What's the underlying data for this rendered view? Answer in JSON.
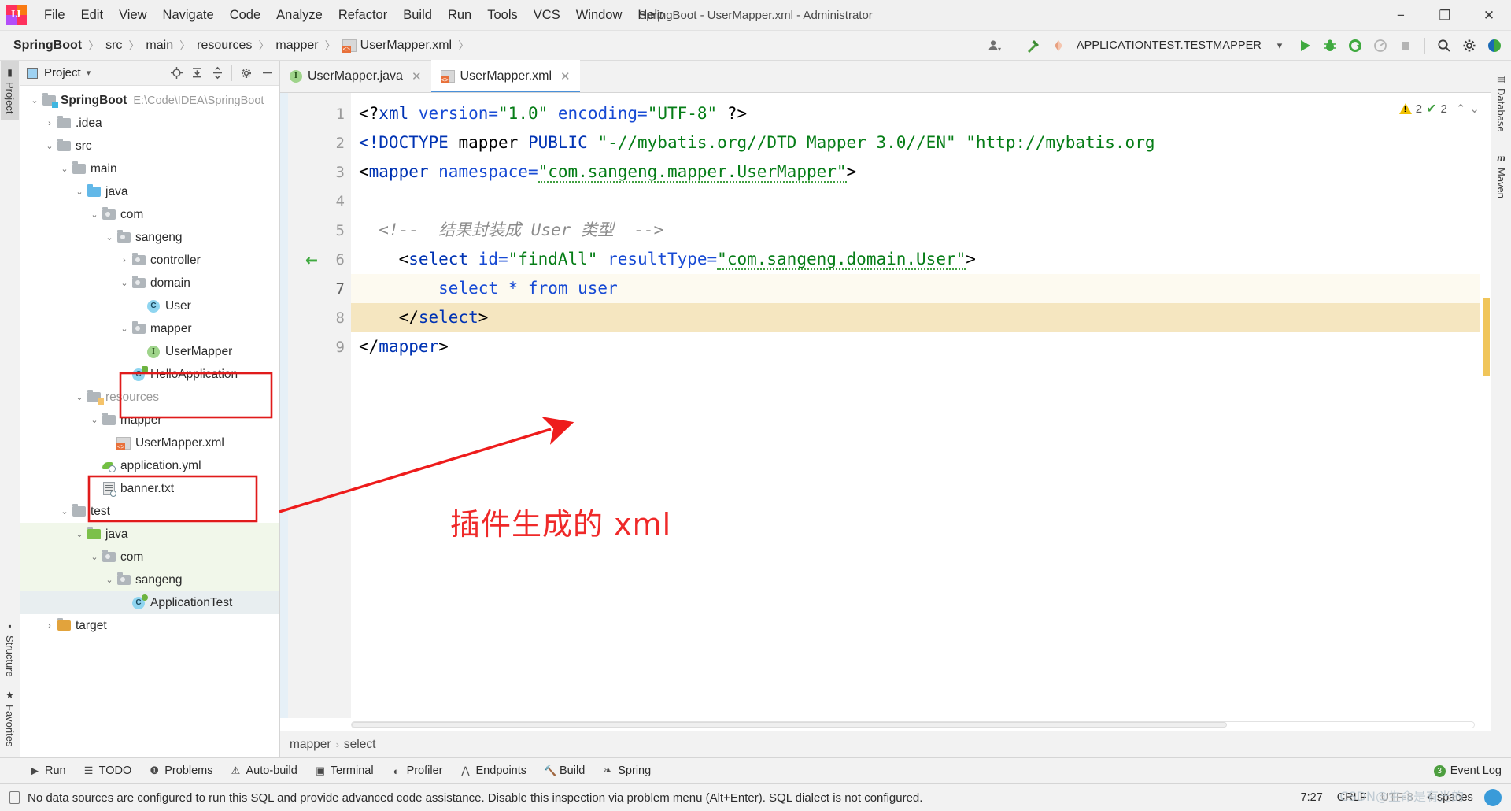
{
  "window": {
    "title": "SpringBoot - UserMapper.xml - Administrator",
    "logo_letters": "IJ",
    "minimize": "−",
    "maximize": "❐",
    "close": "✕"
  },
  "menubar": {
    "items": [
      {
        "label": "File",
        "mnemonic": "F"
      },
      {
        "label": "Edit",
        "mnemonic": "E"
      },
      {
        "label": "View",
        "mnemonic": "V"
      },
      {
        "label": "Navigate",
        "mnemonic": "N"
      },
      {
        "label": "Code",
        "mnemonic": "C"
      },
      {
        "label": "Analyze",
        "mnemonic": "z"
      },
      {
        "label": "Refactor",
        "mnemonic": "R"
      },
      {
        "label": "Build",
        "mnemonic": "B"
      },
      {
        "label": "Run",
        "mnemonic": "u"
      },
      {
        "label": "Tools",
        "mnemonic": "T"
      },
      {
        "label": "VCS",
        "mnemonic": "S"
      },
      {
        "label": "Window",
        "mnemonic": "W"
      },
      {
        "label": "Help",
        "mnemonic": "H"
      }
    ]
  },
  "breadcrumb_nav": {
    "items": [
      "SpringBoot",
      "src",
      "main",
      "resources",
      "mapper",
      "UserMapper.xml"
    ],
    "separator": "〉"
  },
  "nav_right": {
    "run_config": "APPLICATIONTEST.TESTMAPPER",
    "dropdown_caret": "▾",
    "icons": {
      "user": "user-icon",
      "build_hammer": "build-hammer-icon",
      "run": "▶",
      "debug": "debug-icon",
      "run_coverage": "run-coverage-icon",
      "profile": "profiler-icon",
      "stop": "■",
      "search": "⌕",
      "settings": "⚙",
      "ide_help": "ide-ball-icon"
    }
  },
  "left_strip": {
    "tabs": [
      {
        "label": "Project",
        "active": true
      },
      {
        "label": "Structure",
        "active": false
      },
      {
        "label": "Favorites",
        "active": false
      }
    ]
  },
  "right_strip": {
    "tabs": [
      {
        "label": "Database",
        "icon": "database-icon"
      },
      {
        "label": "Maven",
        "icon": "maven-icon"
      }
    ]
  },
  "project_panel": {
    "title": "Project",
    "caret": "▾",
    "actions": [
      "locate-icon",
      "expand-all-icon",
      "collapse-all-icon",
      "gear-icon",
      "hide-icon"
    ],
    "tree": [
      {
        "depth": 0,
        "arrow": "⌄",
        "icon": "project-folder",
        "label": "SpringBoot",
        "bold": true,
        "path": "E:\\Code\\IDEA\\SpringBoot"
      },
      {
        "depth": 1,
        "arrow": "›",
        "icon": "folder",
        "label": ".idea"
      },
      {
        "depth": 1,
        "arrow": "⌄",
        "icon": "folder",
        "label": "src"
      },
      {
        "depth": 2,
        "arrow": "⌄",
        "icon": "folder",
        "label": "main"
      },
      {
        "depth": 3,
        "arrow": "⌄",
        "icon": "folder-blue",
        "label": "java"
      },
      {
        "depth": 4,
        "arrow": "⌄",
        "icon": "package",
        "label": "com"
      },
      {
        "depth": 5,
        "arrow": "⌄",
        "icon": "package",
        "label": "sangeng"
      },
      {
        "depth": 6,
        "arrow": "›",
        "icon": "package",
        "label": "controller"
      },
      {
        "depth": 6,
        "arrow": "⌄",
        "icon": "package",
        "label": "domain"
      },
      {
        "depth": 7,
        "arrow": "",
        "icon": "class",
        "label": "User"
      },
      {
        "depth": 6,
        "arrow": "⌄",
        "icon": "package",
        "label": "mapper",
        "highlighted": true
      },
      {
        "depth": 7,
        "arrow": "",
        "icon": "interface",
        "label": "UserMapper",
        "highlighted": true
      },
      {
        "depth": 6,
        "arrow": "",
        "icon": "spring-class",
        "label": "HelloApplication"
      },
      {
        "depth": 3,
        "arrow": "⌄",
        "icon": "resources-folder",
        "label": "resources",
        "dim": true
      },
      {
        "depth": 4,
        "arrow": "⌄",
        "icon": "folder",
        "label": "mapper",
        "highlighted": true
      },
      {
        "depth": 5,
        "arrow": "",
        "icon": "xml",
        "label": "UserMapper.xml",
        "highlighted": true
      },
      {
        "depth": 4,
        "arrow": "",
        "icon": "yml",
        "label": "application.yml"
      },
      {
        "depth": 4,
        "arrow": "",
        "icon": "txt",
        "label": "banner.txt"
      },
      {
        "depth": 2,
        "arrow": "⌄",
        "icon": "folder",
        "label": "test"
      },
      {
        "depth": 3,
        "arrow": "⌄",
        "icon": "folder-green",
        "label": "java",
        "testroot": true
      },
      {
        "depth": 4,
        "arrow": "⌄",
        "icon": "package",
        "label": "com",
        "testroot": true
      },
      {
        "depth": 5,
        "arrow": "⌄",
        "icon": "package",
        "label": "sangeng",
        "testroot": true
      },
      {
        "depth": 6,
        "arrow": "",
        "icon": "test-class",
        "label": "ApplicationTest",
        "selected": true
      },
      {
        "depth": 1,
        "arrow": "›",
        "icon": "folder-orange",
        "label": "target"
      }
    ]
  },
  "editor": {
    "tabs": [
      {
        "label": "UserMapper.java",
        "icon": "interface-icon",
        "active": false,
        "close": "✕"
      },
      {
        "label": "UserMapper.xml",
        "icon": "xml-icon",
        "active": true,
        "close": "✕"
      }
    ],
    "inspection": {
      "warning_count": "2",
      "check_count": "2",
      "up_caret": "⌃",
      "down_caret": "⌄"
    },
    "line_numbers": [
      "1",
      "2",
      "3",
      "4",
      "5",
      "6",
      "7",
      "8",
      "9"
    ],
    "lines": [
      {
        "n": 1,
        "segments": [
          {
            "t": "<?",
            "c": "plain"
          },
          {
            "t": "xml",
            "c": "tag"
          },
          {
            "t": " version=",
            "c": "attr"
          },
          {
            "t": "\"1.0\"",
            "c": "str"
          },
          {
            "t": " encoding=",
            "c": "attr"
          },
          {
            "t": "\"UTF-8\"",
            "c": "str"
          },
          {
            "t": " ?>",
            "c": "plain"
          }
        ]
      },
      {
        "n": 2,
        "segments": [
          {
            "t": "<!DOCTYPE ",
            "c": "tag"
          },
          {
            "t": "mapper",
            "c": "plain"
          },
          {
            "t": " PUBLIC ",
            "c": "tag"
          },
          {
            "t": "\"-//mybatis.org//DTD Mapper 3.0//EN\"",
            "c": "str"
          },
          {
            "t": " ",
            "c": "plain"
          },
          {
            "t": "\"http://mybatis.org",
            "c": "str"
          }
        ]
      },
      {
        "n": 3,
        "fold": "−",
        "segments": [
          {
            "t": "<",
            "c": "plain"
          },
          {
            "t": "mapper",
            "c": "tag"
          },
          {
            "t": " namespace=",
            "c": "attr"
          },
          {
            "t": "\"com.sangeng.mapper.UserMapper\"",
            "c": "str-squig"
          },
          {
            "t": ">",
            "c": "plain"
          }
        ]
      },
      {
        "n": 4,
        "segments": []
      },
      {
        "n": 5,
        "segments": [
          {
            "t": "  <!--  结果封装成 User 类型  -->",
            "c": "com"
          }
        ]
      },
      {
        "n": 6,
        "marker": "override-arrow",
        "fold": "−",
        "segments": [
          {
            "t": "    <",
            "c": "plain"
          },
          {
            "t": "select",
            "c": "tag"
          },
          {
            "t": " id=",
            "c": "attr"
          },
          {
            "t": "\"findAll\"",
            "c": "str"
          },
          {
            "t": " resultType=",
            "c": "attr"
          },
          {
            "t": "\"com.sangeng.domain.User\"",
            "c": "str-squig"
          },
          {
            "t": ">",
            "c": "plain"
          }
        ]
      },
      {
        "n": 7,
        "highlight": true,
        "current": true,
        "bulb": true,
        "segments": [
          {
            "t": "        select * from user",
            "c": "sql"
          }
        ]
      },
      {
        "n": 8,
        "highlight": true,
        "fold": "−",
        "segments": [
          {
            "t": "    </",
            "c": "plain"
          },
          {
            "t": "select",
            "c": "tag"
          },
          {
            "t": ">",
            "c": "plain"
          }
        ]
      },
      {
        "n": 9,
        "fold": "−",
        "segments": [
          {
            "t": "</",
            "c": "plain"
          },
          {
            "t": "mapper",
            "c": "tag"
          },
          {
            "t": ">",
            "c": "plain"
          }
        ]
      }
    ],
    "bottom_breadcrumb": [
      "mapper",
      "select"
    ],
    "bottom_breadcrumb_sep": "›"
  },
  "annotation": {
    "text": "插件生成的 xml",
    "color": "#ef2929"
  },
  "bottom_toolwindows": {
    "items": [
      {
        "label": "Run",
        "icon": "run-icon"
      },
      {
        "label": "TODO",
        "icon": "todo-icon"
      },
      {
        "label": "Problems",
        "icon": "problems-icon"
      },
      {
        "label": "Auto-build",
        "icon": "autobuild-icon"
      },
      {
        "label": "Terminal",
        "icon": "terminal-icon"
      },
      {
        "label": "Profiler",
        "icon": "profiler-icon"
      },
      {
        "label": "Endpoints",
        "icon": "endpoints-icon"
      },
      {
        "label": "Build",
        "icon": "build-icon"
      },
      {
        "label": "Spring",
        "icon": "spring-icon"
      }
    ],
    "event_log": {
      "label": "Event Log",
      "count": "3"
    }
  },
  "statusbar": {
    "message": "No data sources are configured to run this SQL and provide advanced code assistance. Disable this inspection via problem menu (Alt+Enter). SQL dialect is not configured.",
    "caret_position": "7:27",
    "line_separator": "CRLF",
    "encoding": "UTF-8",
    "indent": "4 spaces",
    "lock": "🔒",
    "theme": "IntelliJ Light"
  },
  "watermark": {
    "text": "CSDN@生命是有光的"
  },
  "colors": {
    "accent": "#4a90d9",
    "red_annotation": "#e01b1b",
    "highlight_line": "#f5e6c0",
    "xml_string": "#067d17",
    "xml_tag": "#0033b3"
  }
}
